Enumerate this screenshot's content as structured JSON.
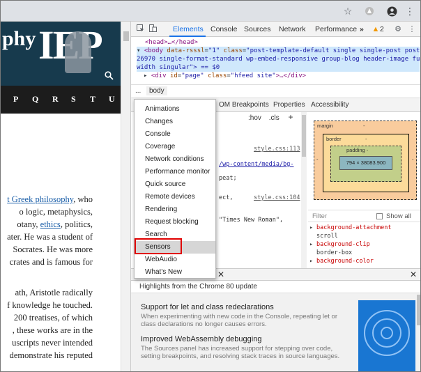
{
  "browser": {
    "icons": [
      "star-icon",
      "extension-icon",
      "account-icon",
      "menu-icon"
    ]
  },
  "page": {
    "logo_text_partial": "phy",
    "logo_text": "IEP",
    "letters": [
      "P",
      "Q",
      "R",
      "S",
      "T",
      "U"
    ],
    "paragraphs": [
      [
        {
          "t": "t Greek philosophy",
          "link": true
        },
        {
          "t": ", who"
        }
      ],
      [
        {
          "t": "o  logic,  metaphysics,"
        }
      ],
      [
        {
          "t": "otany, "
        },
        {
          "t": "ethics",
          "link": true
        },
        {
          "t": ",  politics,"
        }
      ],
      [
        {
          "t": "ater. He was a student of"
        }
      ],
      [
        {
          "t": "Socrates.  He  was  more"
        }
      ],
      [
        {
          "t": "crates and is famous for"
        }
      ],
      [],
      [
        {
          "t": "ath,  Aristotle  radically"
        }
      ],
      [
        {
          "t": "f knowledge he touched."
        }
      ],
      [
        {
          "t": " 200  treatises,  of  which"
        }
      ],
      [
        {
          "t": ", these works are in the"
        }
      ],
      [
        {
          "t": "uscripts never intended"
        }
      ],
      [
        {
          "t": "demonstrate his reputed"
        }
      ]
    ]
  },
  "devtools": {
    "tabs": [
      "Elements",
      "Console",
      "Sources",
      "Network",
      "Performance"
    ],
    "active_tab": "Elements",
    "more_tabs": "»",
    "warnings": "2",
    "dom": {
      "line1": "<head>…</head>",
      "line2_tag": "<body",
      "line2_attr1": "data-rsssl",
      "line2_val1": "\"1\"",
      "line2_attr2": "class",
      "line2_val2": "\"post-template-default single single-post postid-",
      "line3": "26970 single-format-standard wp-embed-responsive group-blog header-image full-",
      "line4": "width singular\"> == $0",
      "line5_tag": "<div",
      "line5_attr": "id",
      "line5_val": "\"page\"",
      "line5_attr2": "class",
      "line5_val2": "\"hfeed site\"",
      "line5_end": ">…</div>"
    },
    "breadcrumb": {
      "dots": "...",
      "body": "body"
    },
    "subtabs": [
      "OM Breakpoints",
      "Properties",
      "Accessibility"
    ],
    "hov": ":hov",
    "cls": ".cls",
    "plus": "+",
    "styles": {
      "link1": "style.css:113",
      "url1": "/wp-content/media/bg-",
      "r1": "peat;",
      "r2": "ect,",
      "link2": "style.css:104",
      "r3": "\"Times New Roman\","
    },
    "boxmodel": {
      "margin": "margin",
      "margin_val": "-",
      "border": "border",
      "border_val": "-",
      "padding": "padding -",
      "content": "794 × 38083.900",
      "side_dash": "-"
    },
    "filter": {
      "placeholder": "Filter",
      "show_all": "Show all"
    },
    "computed": [
      {
        "prop": "background-attachment",
        "value": "scroll"
      },
      {
        "prop": "background-clip",
        "value": "border-box"
      },
      {
        "prop": "background-color",
        "value": ""
      }
    ],
    "drawer": {
      "close": "✕",
      "highlights": "Highlights from the Chrome 80 update",
      "items": [
        {
          "title": "Support for let and class redeclarations",
          "desc": "When experimenting with new code in the Console, repeating let or class declarations no longer causes errors."
        },
        {
          "title": "Improved WebAssembly debugging",
          "desc": "The Sources panel has increased support for stepping over code, setting breakpoints, and resolving stack traces in source languages."
        }
      ]
    },
    "menu": {
      "items": [
        "Animations",
        "Changes",
        "Console",
        "Coverage",
        "Network conditions",
        "Performance monitor",
        "Quick source",
        "Remote devices",
        "Rendering",
        "Request blocking",
        "Search",
        "Sensors",
        "WebAudio",
        "What's New"
      ],
      "highlighted": "Sensors"
    }
  }
}
